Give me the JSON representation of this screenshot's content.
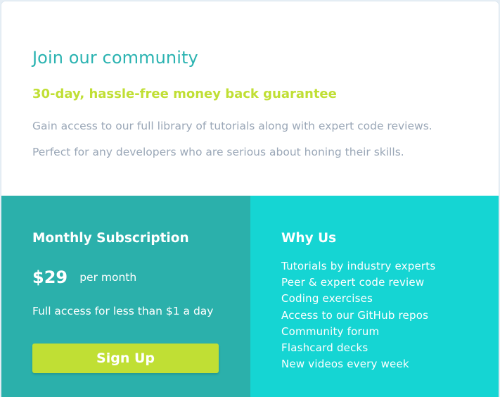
{
  "community": {
    "title": "Join our community",
    "subtitle": "30-day, hassle-free money back guarantee",
    "description_1": "Gain access to our full library of tutorials along with expert code reviews.",
    "description_2": "Perfect for any developers who are serious about honing their skills."
  },
  "subscription": {
    "title": "Monthly Subscription",
    "price": "$29",
    "period": "per month",
    "tagline": "Full access for less than $1 a day",
    "button_label": "Sign Up"
  },
  "why_us": {
    "title": "Why Us",
    "items": [
      "Tutorials by industry experts",
      "Peer & expert code review",
      "Coding exercises",
      "Access to our GitHub repos",
      "Community forum",
      "Flashcard decks",
      "New videos every week"
    ]
  },
  "colors": {
    "teal_dark": "#2bb0ab",
    "teal_light": "#15d5d3",
    "lime": "#c0df34",
    "grey_text": "#9aa7b7"
  }
}
